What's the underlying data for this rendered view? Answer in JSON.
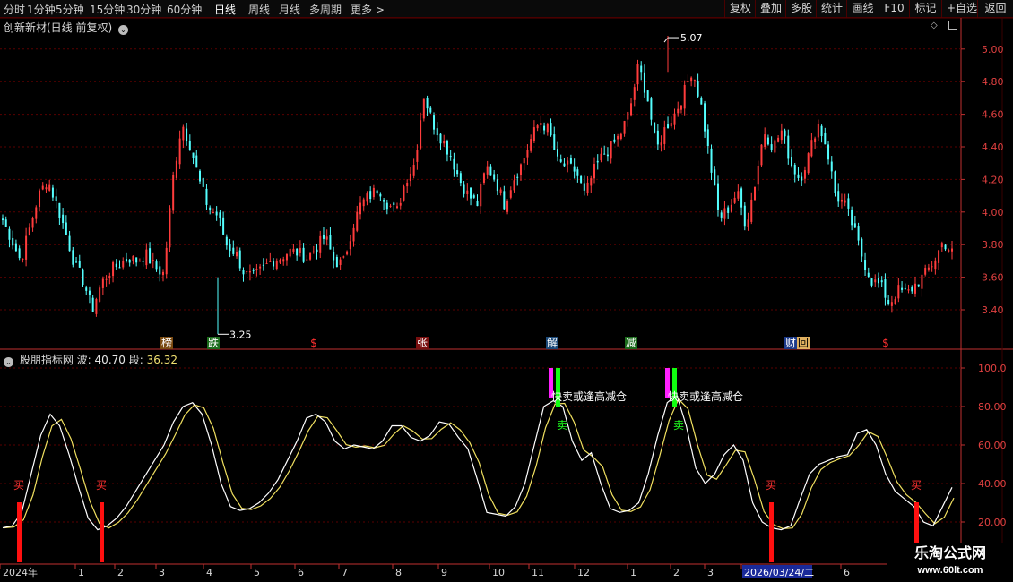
{
  "toolbar": {
    "timeframes": [
      {
        "label": "分时",
        "active": false
      },
      {
        "label": "1分钟",
        "active": false
      },
      {
        "label": "5分钟",
        "active": false
      },
      {
        "label": "15分钟",
        "active": false
      },
      {
        "label": "30分钟",
        "active": false
      },
      {
        "label": "60分钟",
        "active": false
      },
      {
        "label": "日线",
        "active": true
      },
      {
        "label": "周线",
        "active": false
      },
      {
        "label": "月线",
        "active": false
      },
      {
        "label": "多周期",
        "active": false
      },
      {
        "label": "更多 >",
        "active": false
      }
    ],
    "buttons": [
      "复权",
      "叠加",
      "多股",
      "统计",
      "画线",
      "F10",
      "标记",
      "+自选",
      "返回"
    ]
  },
  "main_header": {
    "title": "创新新材(日线 前复权)",
    "icon": "chevron-down-icon"
  },
  "indicator_header": {
    "name": "股朋指标网",
    "bo_label": "波:",
    "bo_value": "40.70",
    "duan_label": "段:",
    "duan_value": "36.32",
    "icon": "chevron-down-icon"
  },
  "price_axis": [
    "5.00",
    "4.80",
    "4.60",
    "4.40",
    "4.20",
    "4.00",
    "3.80",
    "3.60",
    "3.40"
  ],
  "indicator_axis": [
    "100.0",
    "80.00",
    "60.00",
    "40.00",
    "20.00"
  ],
  "price_annotations": {
    "high": "5.07",
    "low": "3.25"
  },
  "event_markers": [
    {
      "text": "榜",
      "color": "#ffffff",
      "bg": "#7a4a10"
    },
    {
      "text": "跌",
      "color": "#ffffff",
      "bg": "#1c6c1c"
    },
    {
      "text": "$",
      "color": "#ff3030",
      "bg": ""
    },
    {
      "text": "张",
      "color": "#ffffff",
      "bg": "#7a1010"
    },
    {
      "text": "解",
      "color": "#ffffff",
      "bg": "#1c4a7a"
    },
    {
      "text": "减",
      "color": "#ffffff",
      "bg": "#1c6c1c"
    },
    {
      "text": "财",
      "color": "#ffffff",
      "bg": "#1c3a8a"
    },
    {
      "text": "回",
      "color": "#000000",
      "bg": "#e0b060"
    },
    {
      "text": "$",
      "color": "#ff3030",
      "bg": ""
    }
  ],
  "indicator_signals": {
    "buy_label": "买",
    "sell_label": "卖",
    "warn_label": "快卖或逢高减仓"
  },
  "date_axis": {
    "labels": [
      "2024年",
      "1",
      "2",
      "3",
      "4",
      "5",
      "6",
      "7",
      "8",
      "9",
      "10",
      "11",
      "12",
      "1",
      "2",
      "3",
      "2026/03/24/二",
      "6"
    ],
    "highlight": "2026/03/24/二"
  },
  "watermark": {
    "title": "乐淘公式网",
    "url": "www.60lt.com"
  },
  "colors": {
    "up": "#ff3c3c",
    "down": "#54ffff",
    "line_white": "#ffffff",
    "line_yellow": "#f0e060",
    "grid": "#5a0000",
    "axis": "#c03030",
    "buy_bar": "#ff1010",
    "sell_bar_green": "#10ff10",
    "sell_bar_magenta": "#ff20ff"
  },
  "chart_data": {
    "type": "candlestick",
    "ylim": [
      3.25,
      5.07
    ],
    "close_path": [
      3.95,
      3.83,
      3.7,
      3.9,
      4.1,
      4.2,
      4.05,
      3.88,
      3.68,
      3.58,
      3.4,
      3.56,
      3.64,
      3.68,
      3.72,
      3.7,
      3.74,
      3.66,
      3.62,
      4.2,
      4.55,
      4.4,
      4.18,
      4.02,
      3.98,
      3.8,
      3.75,
      3.62,
      3.6,
      3.65,
      3.7,
      3.72,
      3.76,
      3.75,
      3.72,
      3.78,
      3.85,
      3.7,
      3.68,
      3.9,
      4.05,
      4.1,
      4.15,
      4.05,
      4.0,
      4.2,
      4.3,
      4.72,
      4.55,
      4.45,
      4.35,
      4.2,
      4.1,
      4.05,
      4.28,
      4.2,
      4.05,
      4.2,
      4.3,
      4.45,
      4.56,
      4.5,
      4.3,
      4.28,
      4.25,
      4.1,
      4.25,
      4.35,
      4.4,
      4.48,
      4.62,
      4.9,
      4.7,
      4.38,
      4.52,
      4.6,
      4.72,
      4.88,
      4.65,
      4.3,
      3.96,
      4.02,
      4.12,
      3.92,
      4.18,
      4.5,
      4.4,
      4.5,
      4.3,
      4.2,
      4.35,
      4.55,
      4.4,
      4.1,
      4.05,
      3.9,
      3.72,
      3.58,
      3.55,
      3.44,
      3.52,
      3.5,
      3.56,
      3.62,
      3.7,
      3.82,
      3.75
    ]
  },
  "indicator_data": {
    "type": "line",
    "ylim": [
      20,
      100
    ],
    "series_points": [
      17,
      18,
      25,
      45,
      65,
      76,
      70,
      55,
      38,
      22,
      16,
      18,
      22,
      28,
      36,
      44,
      52,
      60,
      72,
      80,
      82,
      76,
      60,
      40,
      28,
      26,
      27,
      30,
      35,
      42,
      52,
      62,
      74,
      76,
      72,
      62,
      58,
      60,
      59,
      58,
      62,
      70,
      70,
      64,
      62,
      65,
      72,
      71,
      64,
      58,
      42,
      25,
      24,
      23,
      28,
      40,
      60,
      80,
      83,
      80,
      62,
      52,
      56,
      40,
      27,
      25,
      26,
      30,
      45,
      65,
      82,
      86,
      70,
      48,
      40,
      45,
      55,
      60,
      52,
      30,
      20,
      17,
      16,
      18,
      32,
      45,
      50,
      52,
      54,
      55,
      66,
      68,
      60,
      45,
      36,
      32,
      28,
      20,
      18,
      28,
      38
    ]
  }
}
